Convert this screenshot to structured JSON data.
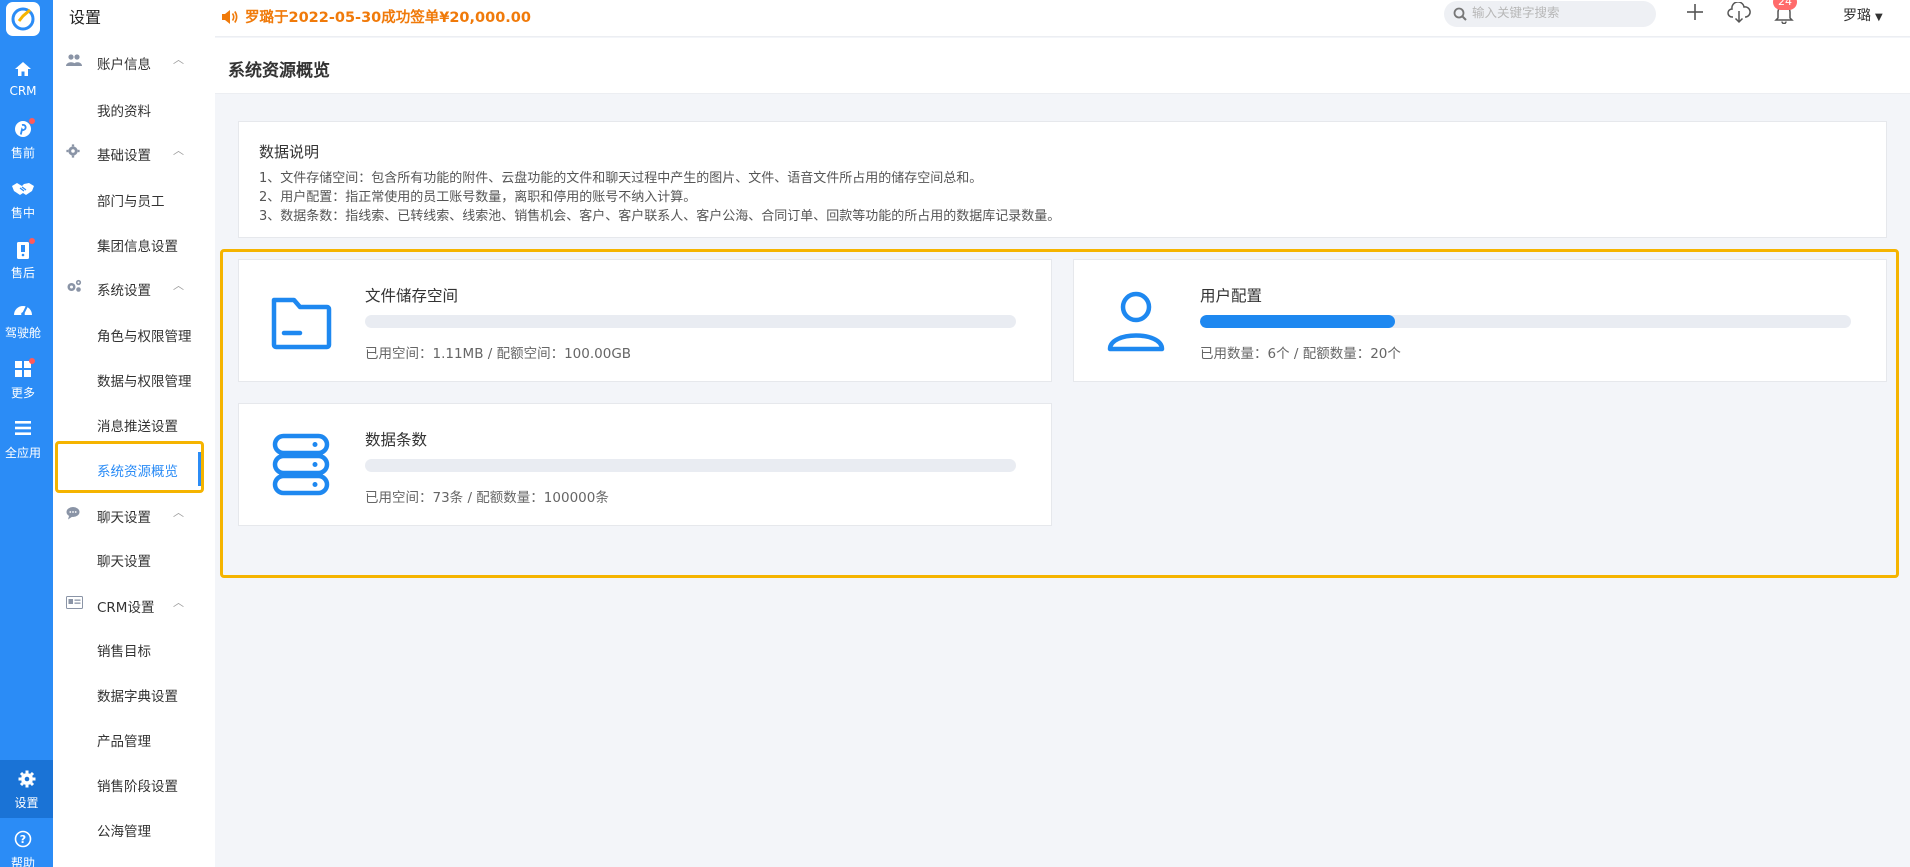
{
  "app": {
    "title": "设置",
    "colors": {
      "primary": "#2b8cf6",
      "highlight": "#f5b400",
      "notice": "#f07a0a"
    }
  },
  "rail": {
    "items": [
      {
        "label": "CRM",
        "icon": "home-icon"
      },
      {
        "label": "售前",
        "icon": "pinterest-icon",
        "dot": true
      },
      {
        "label": "售中",
        "icon": "handshake-icon"
      },
      {
        "label": "售后",
        "icon": "clipboard-icon",
        "dot": true
      },
      {
        "label": "驾驶舱",
        "icon": "dashboard-icon"
      },
      {
        "label": "更多",
        "icon": "grid-icon",
        "dot": true
      },
      {
        "label": "全应用",
        "icon": "menu-icon"
      },
      {
        "label": "设置",
        "icon": "gear-icon",
        "active": true
      },
      {
        "label": "帮助",
        "icon": "help-icon"
      }
    ]
  },
  "sidebar": {
    "sections": [
      {
        "label": "账户信息",
        "icon": "users-icon",
        "items": [
          "我的资料"
        ]
      },
      {
        "label": "基础设置",
        "icon": "gear-icon",
        "items": [
          "部门与员工",
          "集团信息设置"
        ]
      },
      {
        "label": "系统设置",
        "icon": "gears-icon",
        "items": [
          "角色与权限管理",
          "数据与权限管理",
          "消息推送设置",
          "系统资源概览"
        ]
      },
      {
        "label": "聊天设置",
        "icon": "chat-icon",
        "items": [
          "聊天设置"
        ]
      },
      {
        "label": "CRM设置",
        "icon": "id-card-icon",
        "items": [
          "销售目标",
          "数据字典设置",
          "产品管理",
          "销售阶段设置",
          "公海管理"
        ]
      }
    ],
    "active_item": "系统资源概览"
  },
  "topbar": {
    "notice": "罗璐于2022-05-30成功签单¥20,000.00",
    "search_placeholder": "输入关键字搜索",
    "notification_count": "24",
    "user_name": "罗璐"
  },
  "page": {
    "title": "系统资源概览",
    "info": {
      "heading": "数据说明",
      "lines": [
        "1、文件存储空间：包含所有功能的附件、云盘功能的文件和聊天过程中产生的图片、文件、语音文件所占用的储存空间总和。",
        "2、用户配置：指正常使用的员工账号数量，离职和停用的账号不纳入计算。",
        "3、数据条数：指线索、已转线索、线索池、销售机会、客户、客户联系人、客户公海、合同订单、回款等功能的所占用的数据库记录数量。"
      ]
    },
    "cards": [
      {
        "title": "文件储存空间",
        "icon": "folder-icon",
        "usage": 0.0,
        "desc": "已用空间：1.11MB / 配额空间：100.00GB"
      },
      {
        "title": "用户配置",
        "icon": "user-icon",
        "usage": 0.3,
        "desc": "已用数量：6个 / 配额数量：20个"
      },
      {
        "title": "数据条数",
        "icon": "database-icon",
        "usage": 0.0,
        "desc": "已用空间：73条 / 配额数量：100000条"
      }
    ]
  }
}
